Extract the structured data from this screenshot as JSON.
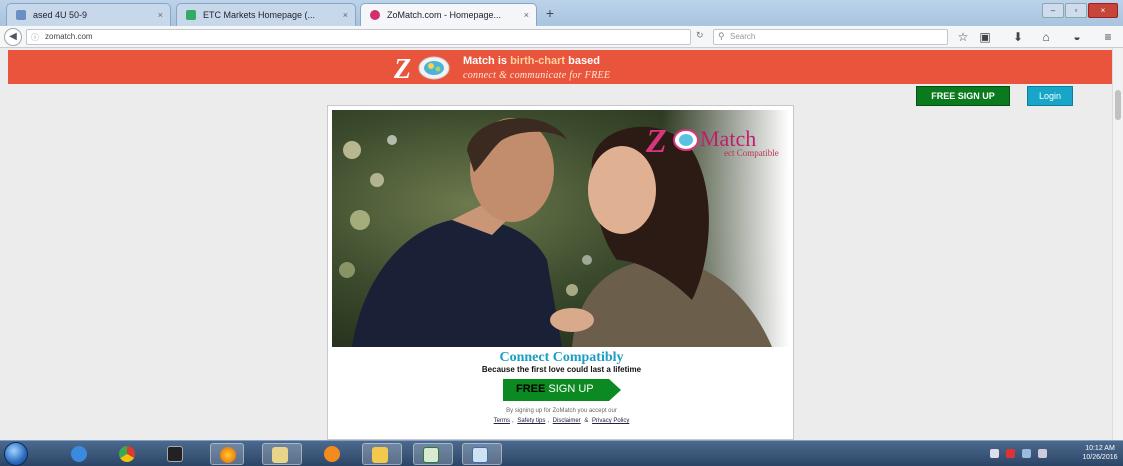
{
  "browser": {
    "tabs": [
      {
        "label": "ased 4U 50-9",
        "active": false
      },
      {
        "label": "ETC Markets Homepage (...",
        "active": false
      },
      {
        "label": "ZoMatch.com - Homepage...",
        "active": true
      }
    ],
    "tab_close_glyph": "×",
    "new_tab_glyph": "+",
    "window_controls": [
      "–",
      "▫",
      "×"
    ],
    "back_glyph": "◀",
    "url": "zomatch.com",
    "url_info_glyph": "ⓘ",
    "reload_glyph": "↻",
    "search_placeholder": "Search",
    "search_glyph": "⚲",
    "toolbar_icons": [
      "star-icon",
      "clipboard-icon",
      "download-icon",
      "home-icon",
      "pocket-icon",
      "menu-icon"
    ],
    "toolbar_glyphs": [
      "☆",
      "▣",
      "⬇",
      "⌂",
      "◒",
      "≡"
    ]
  },
  "page": {
    "banner": {
      "line1_pre": "Match is",
      "line1_highlight": "birth-chart",
      "line1_post": "based",
      "line2": "connect & communicate for FREE"
    },
    "header_buttons": {
      "signup": "FREE SIGN UP",
      "login": "Login"
    },
    "brand": {
      "word": "Match",
      "sub": "ect Compatible"
    },
    "tagline": "Connect Compatibly",
    "subline": "Because the first love could last a lifetime",
    "cta": {
      "free": "FREE",
      "rest": "SIGN UP"
    },
    "fine_print": "By signing up for ZoMatch you accept our",
    "links": [
      "Terms",
      "Safety tips",
      "Disclaimer",
      "Privacy Policy"
    ],
    "colors": {
      "banner": "#e8553c",
      "signup_green": "#0a7a1e",
      "login_blue": "#17a6c8",
      "tagline_blue": "#1a9ec4",
      "brand_pink": "#c21d6a"
    }
  },
  "taskbar": {
    "apps": [
      "ie-icon",
      "chrome-icon",
      "media-icon",
      "firefox-icon",
      "explorer-icon",
      "player-icon",
      "folder-icon",
      "excel-icon",
      "paint-icon"
    ],
    "clock_time": "10:12 AM",
    "clock_date": "10/26/2016"
  }
}
